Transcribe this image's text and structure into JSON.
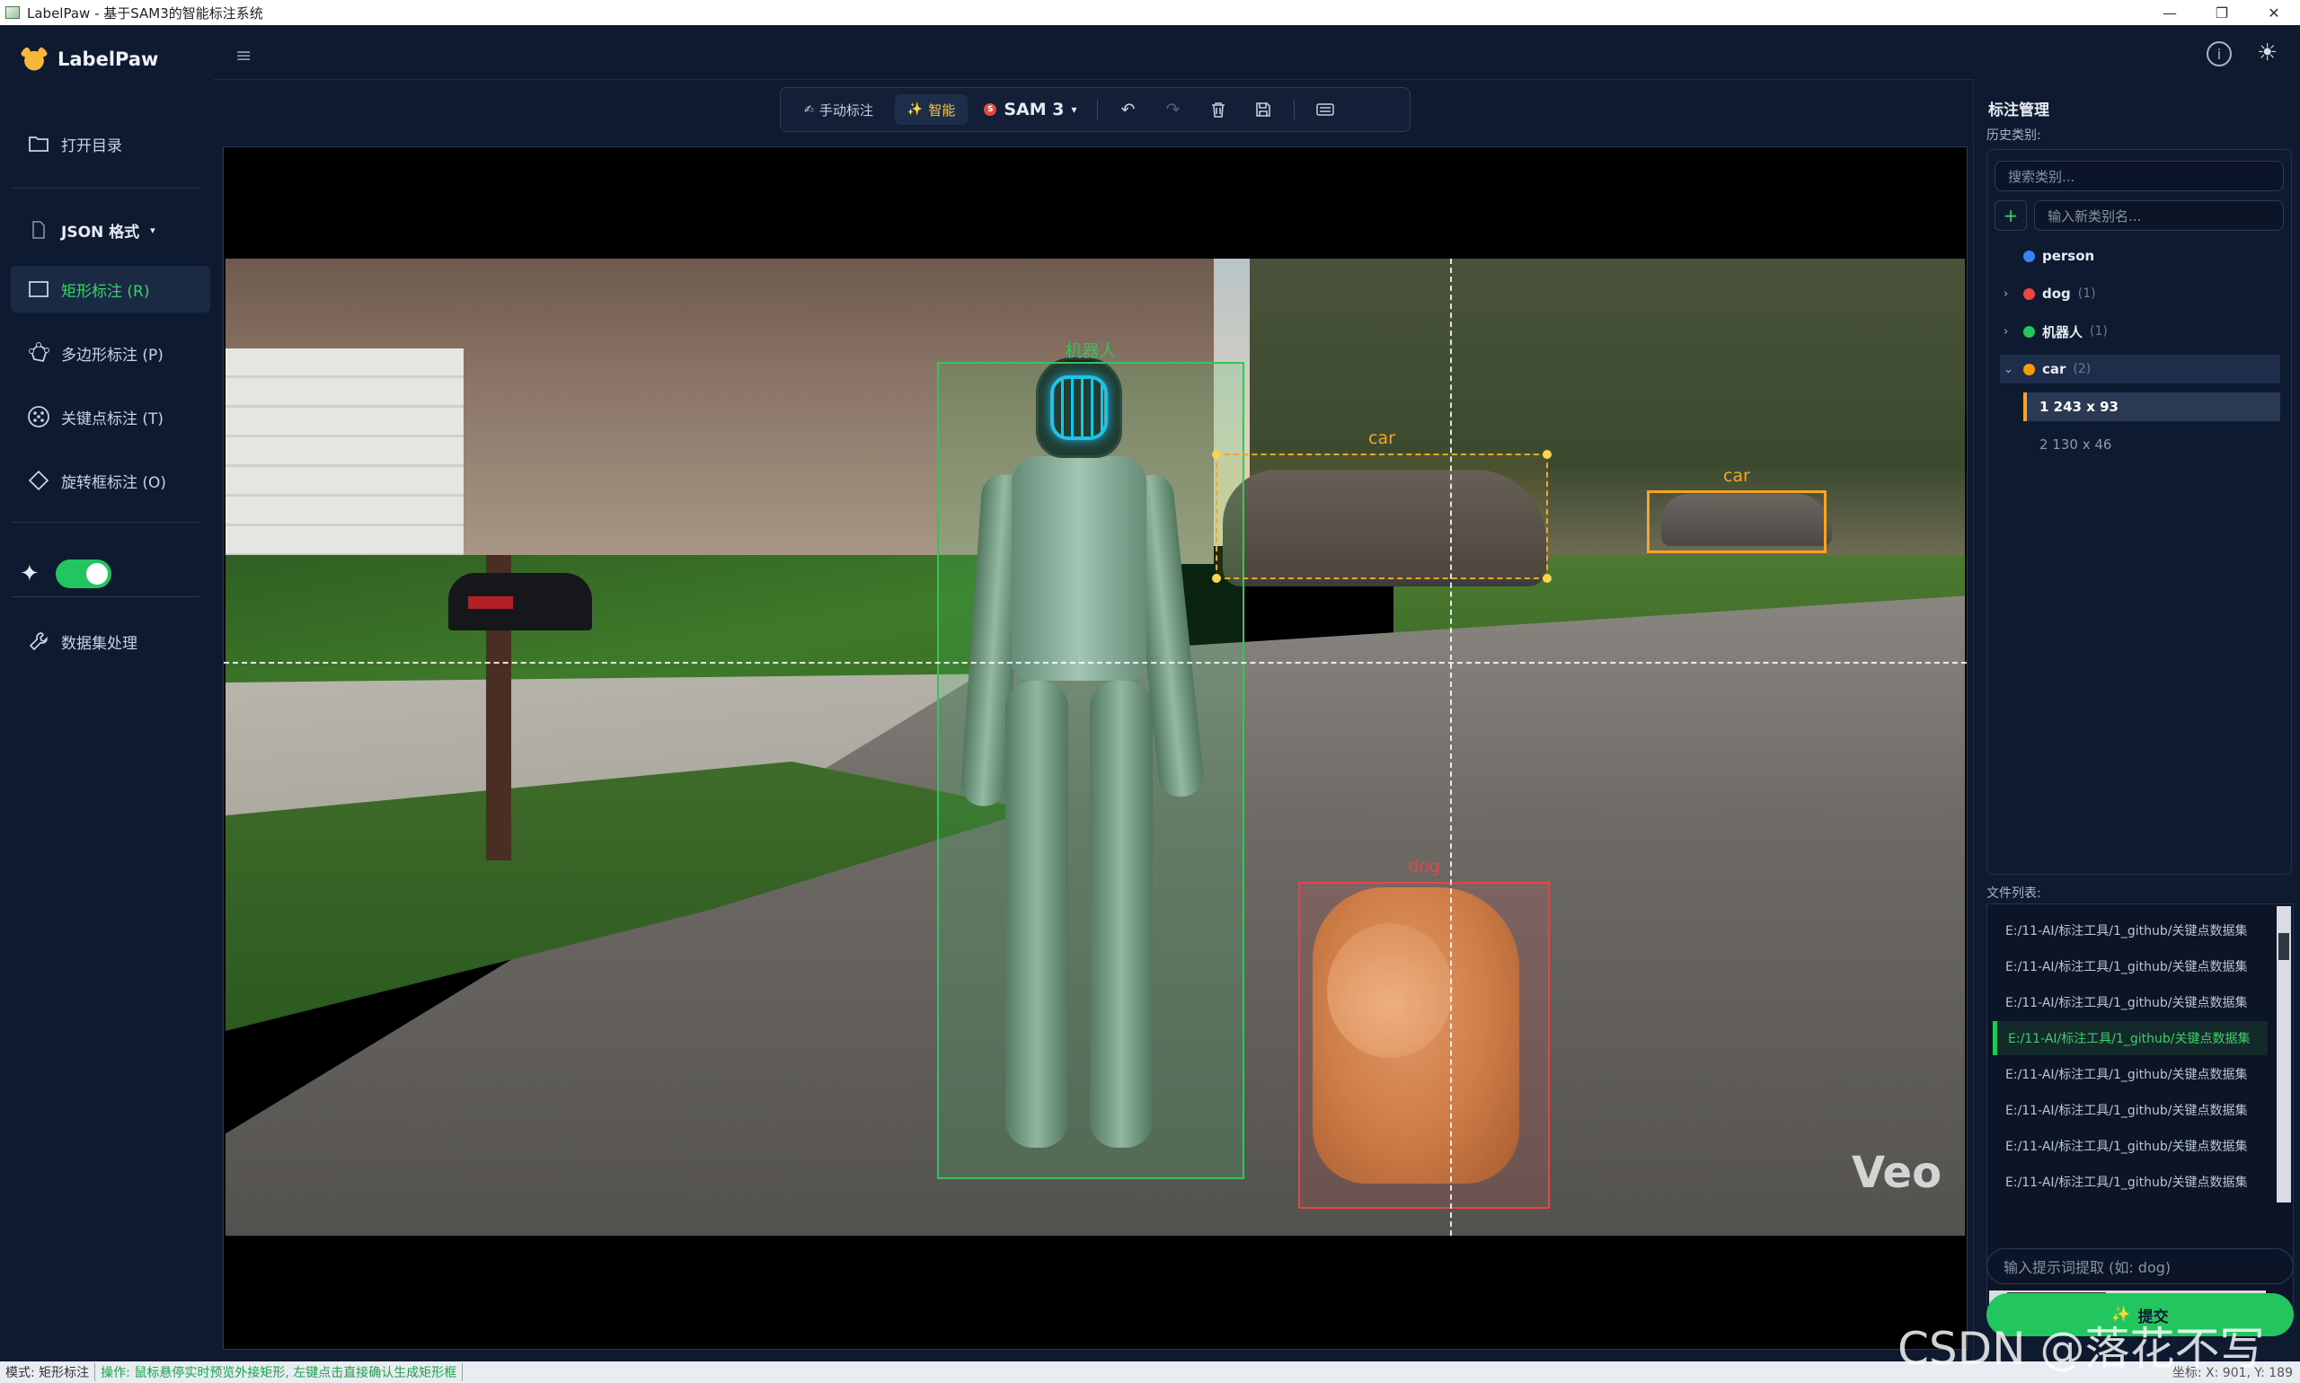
{
  "window": {
    "title": "LabelPaw - 基于SAM3的智能标注系统",
    "controls": [
      "—",
      "❐",
      "✕"
    ]
  },
  "sidebar": {
    "logo": "LabelPaw",
    "open_dir": "打开目录",
    "format": "JSON 格式",
    "tools": [
      {
        "label": "矩形标注 (R)",
        "icon": "rectangle-icon"
      },
      {
        "label": "多边形标注 (P)",
        "icon": "polygon-icon"
      },
      {
        "label": "关键点标注 (T)",
        "icon": "keypoint-icon"
      },
      {
        "label": "旋转框标注 (O)",
        "icon": "rotated-box-icon"
      }
    ],
    "smart_toggle_on": true,
    "dataset": "数据集处理"
  },
  "toolbar": {
    "manual": "手动标注",
    "smart": "智能",
    "model": "SAM 3",
    "model_badge": "S"
  },
  "canvas": {
    "watermark": "Veo",
    "annotations": {
      "robot": "机器人",
      "car1": "car",
      "car2": "car",
      "dog": "dog"
    }
  },
  "panel": {
    "title": "标注管理",
    "history": "历史类别:",
    "search_placeholder": "搜索类别...",
    "new_placeholder": "输入新类别名...",
    "categories": [
      {
        "name": "person",
        "count": "",
        "color": "#3b82f6",
        "chev": ""
      },
      {
        "name": "dog",
        "count": "(1)",
        "color": "#ef4444",
        "chev": "›"
      },
      {
        "name": "机器人",
        "count": "(1)",
        "color": "#22c55e",
        "chev": "›"
      },
      {
        "name": "car",
        "count": "(2)",
        "color": "#f59e0b",
        "chev": "⌄"
      }
    ],
    "instances": [
      "1 243 x 93",
      "2 130 x 46"
    ],
    "files_title": "文件列表:",
    "files": [
      "E:/11-AI/标注工具/1_github/关键点数据集",
      "E:/11-AI/标注工具/1_github/关键点数据集",
      "E:/11-AI/标注工具/1_github/关键点数据集",
      "E:/11-AI/标注工具/1_github/关键点数据集",
      "E:/11-AI/标注工具/1_github/关键点数据集",
      "E:/11-AI/标注工具/1_github/关键点数据集",
      "E:/11-AI/标注工具/1_github/关键点数据集",
      "E:/11-AI/标注工具/1_github/关键点数据集"
    ],
    "selected_file": 3,
    "prompt_placeholder": "输入提示词提取 (如: dog)",
    "submit": "提交"
  },
  "status": {
    "mode": "模式: 矩形标注",
    "op": "操作: 鼠标悬停实时预览外接矩形, 左键点击直接确认生成矩形框",
    "coord": "坐标: X: 901, Y: 189"
  },
  "page_watermark": "CSDN @落花不写码"
}
